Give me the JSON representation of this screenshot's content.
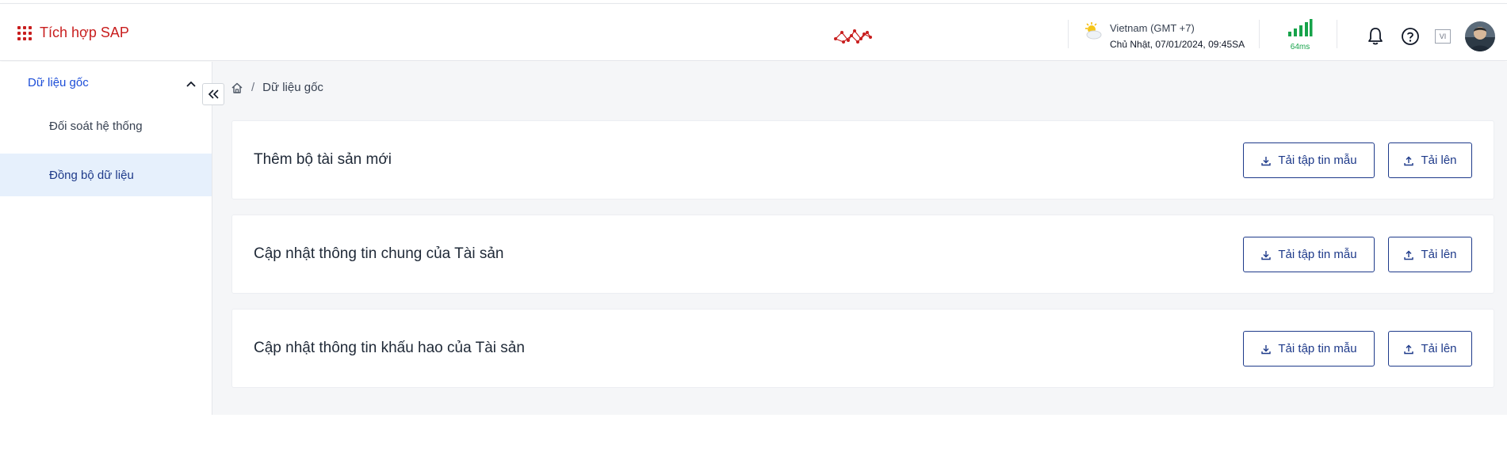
{
  "header": {
    "app_title": "Tích hợp SAP",
    "weather": {
      "location": "Vietnam (GMT +7)",
      "datetime": "Chủ Nhật, 07/01/2024, 09:45SA"
    },
    "latency": "64ms",
    "language": "VI"
  },
  "sidebar": {
    "group_label": "Dữ liệu gốc",
    "items": [
      {
        "label": "Đối soát hệ thống",
        "active": false
      },
      {
        "label": "Đồng bộ dữ liệu",
        "active": true
      }
    ]
  },
  "breadcrumb": {
    "current": "Dữ liệu gốc"
  },
  "cards": [
    {
      "title": "Thêm bộ tài sản mới",
      "template_label": "Tải tập tin mẫu",
      "upload_label": "Tải lên"
    },
    {
      "title": "Cập nhật thông tin chung của Tài sản",
      "template_label": "Tải tập tin mẫu",
      "upload_label": "Tải lên"
    },
    {
      "title": "Cập nhật thông tin khấu hao của Tài sản",
      "template_label": "Tải tập tin mẫu",
      "upload_label": "Tải lên"
    }
  ],
  "colors": {
    "brand": "#c81e1e",
    "primary": "#1e3a8a",
    "active_bg": "#e6f0fc",
    "signal": "#16a34a"
  }
}
